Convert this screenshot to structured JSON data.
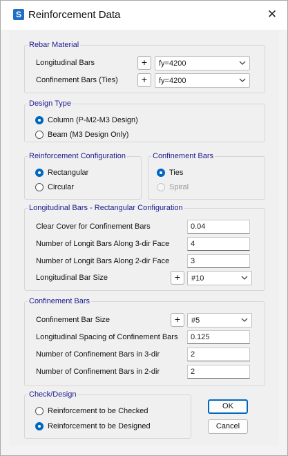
{
  "window": {
    "title": "Reinforcement Data",
    "app_icon_letter": "S",
    "close_glyph": "✕"
  },
  "rebar_material": {
    "legend": "Rebar Material",
    "rows": [
      {
        "label": "Longitudinal Bars",
        "plus": "+",
        "value": "fy=4200"
      },
      {
        "label": "Confinement Bars  (Ties)",
        "plus": "+",
        "value": "fy=4200"
      }
    ]
  },
  "design_type": {
    "legend": "Design Type",
    "options": [
      {
        "label": "Column  (P-M2-M3 Design)",
        "selected": true
      },
      {
        "label": "Beam  (M3 Design Only)",
        "selected": false
      }
    ]
  },
  "reinforcement_configuration": {
    "legend": "Reinforcement Configuration",
    "options": [
      {
        "label": "Rectangular",
        "selected": true
      },
      {
        "label": "Circular",
        "selected": false
      }
    ]
  },
  "confinement_bars_type": {
    "legend": "Confinement Bars",
    "options": [
      {
        "label": "Ties",
        "selected": true,
        "enabled": true
      },
      {
        "label": "Spiral",
        "selected": false,
        "enabled": false
      }
    ]
  },
  "longitudinal_bars": {
    "legend": "Longitudinal Bars - Rectangular Configuration",
    "clear_cover": {
      "label": "Clear Cover for Confinement Bars",
      "value": "0.04"
    },
    "bars_3dir": {
      "label": "Number of Longit Bars Along 3-dir Face",
      "value": "4"
    },
    "bars_2dir": {
      "label": "Number of Longit Bars Along 2-dir Face",
      "value": "3"
    },
    "bar_size": {
      "label": "Longitudinal Bar Size",
      "plus": "+",
      "value": "#10"
    }
  },
  "confinement_bars": {
    "legend": "Confinement Bars",
    "bar_size": {
      "label": "Confinement Bar Size",
      "plus": "+",
      "value": "#5"
    },
    "spacing": {
      "label": "Longitudinal Spacing of Confinement Bars",
      "value": "0.125"
    },
    "bars_3dir": {
      "label": "Number of Confinement Bars in 3-dir",
      "value": "2"
    },
    "bars_2dir": {
      "label": "Number of Confinement Bars in 2-dir",
      "value": "2"
    }
  },
  "check_design": {
    "legend": "Check/Design",
    "options": [
      {
        "label": "Reinforcement to be Checked",
        "selected": false
      },
      {
        "label": "Reinforcement to be Designed",
        "selected": true
      }
    ]
  },
  "buttons": {
    "ok": "OK",
    "cancel": "Cancel"
  },
  "colors": {
    "accent": "#0067c0",
    "legend_text": "#1b1b8f",
    "app_icon": "#1f6fc5"
  }
}
